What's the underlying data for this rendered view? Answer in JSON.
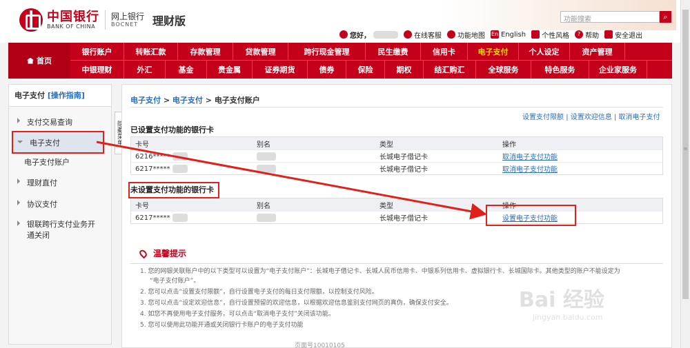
{
  "header": {
    "logo_cn": "中国银行",
    "logo_en": "BANK OF CHINA",
    "net_cn": "网上银行",
    "net_en": "BOCNET",
    "edition": "理财版",
    "search_placeholder": "功能搜索",
    "topbar": {
      "greeting": "您好，",
      "message_box": "在线客服",
      "site_map": "功能地图",
      "english": "English",
      "style": "个性风格",
      "help": "帮助",
      "logout": "安全退出"
    }
  },
  "nav": {
    "home": "首页",
    "row1": [
      "银行账户",
      "转账汇款",
      "存款管理",
      "贷款管理",
      "跨行现金管理",
      "民生缴费",
      "信用卡",
      "电子支付",
      "个人设定",
      "资产管理"
    ],
    "row2": [
      "中银理财",
      "外汇",
      "基金",
      "贵金属",
      "证券期货",
      "债券",
      "保险",
      "期权",
      "结汇购汇",
      "全球服务",
      "特色服务",
      "企业家服务"
    ],
    "active": "电子支付"
  },
  "sidebar": {
    "title": "电子支付",
    "guide": "[操作指南]",
    "items": [
      "支付交易查询",
      "电子支付",
      "电子支付账户",
      "理财直付",
      "协议支付",
      "银联跨行支付业务开",
      "通关闭"
    ],
    "collapse_label": "隐藏菜单"
  },
  "main": {
    "crumb": [
      "电子支付",
      ">",
      "电子支付",
      ">",
      "电子支付账户"
    ],
    "actions": [
      "设置支付限额",
      "|",
      "设置欢迎信息",
      "|",
      "取消电子支付"
    ],
    "set_section_title": "已设置支付功能的银行卡",
    "unset_section_title": "未设置支付功能的银行卡",
    "columns": [
      "卡号",
      "别名",
      "类型",
      "操作"
    ],
    "set_rows": [
      {
        "card": "6216*****",
        "type": "长城电子借记卡",
        "action": "取消电子支付功能"
      },
      {
        "card": "6217*****",
        "type": "长城电子借记卡",
        "action": "取消电子支付功能"
      }
    ],
    "unset_rows": [
      {
        "card": "6217*****",
        "type": "长城电子借记卡",
        "action": "设置电子支付功能"
      }
    ],
    "tips_title": "温馨提示",
    "tips": [
      "1. 您的网银关联账户中的以下类型可以设置为“电子支付账户”：长城电子借记卡、长城人民币信用卡、中银系列信用卡、虚拟银行卡、长城国际卡。其他类型的账户不能设定为",
      "“电子支付账户”。",
      "2. 您可以点击“设置支付限额”，自行设置电子支付的每日支付限额，以控制支付风险。",
      "3. 您可以点击“设定欢迎信息”，自行设置预留的欢迎信息，以根据欢迎信息鉴别支付网页的真伪，确保支付安全。",
      "4. 如您不再使用电子支付服务，可以点击“取消电子支付”关闭该功能。",
      "5. 您可以使用此功能开通或关闭银行卡账户的电子支付功能"
    ],
    "footer_code": "页面号10010105"
  },
  "watermark": {
    "text": "Bai 经验",
    "sub": "jingyan.baidu.com"
  },
  "colors": {
    "brand": "#c4001a",
    "link": "#2a6ebb",
    "annotation": "#e0201a",
    "nav_active": "#ffd800"
  }
}
